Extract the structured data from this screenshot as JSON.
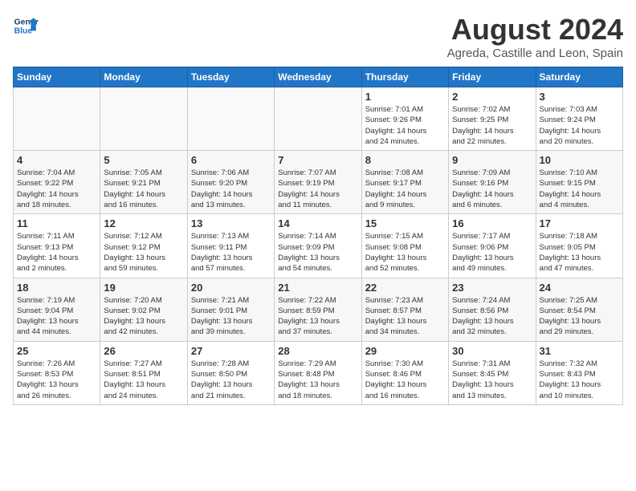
{
  "header": {
    "logo_line1": "General",
    "logo_line2": "Blue",
    "title": "August 2024",
    "subtitle": "Agreda, Castille and Leon, Spain"
  },
  "days_of_week": [
    "Sunday",
    "Monday",
    "Tuesday",
    "Wednesday",
    "Thursday",
    "Friday",
    "Saturday"
  ],
  "weeks": [
    [
      {
        "day": "",
        "content": ""
      },
      {
        "day": "",
        "content": ""
      },
      {
        "day": "",
        "content": ""
      },
      {
        "day": "",
        "content": ""
      },
      {
        "day": "1",
        "content": "Sunrise: 7:01 AM\nSunset: 9:26 PM\nDaylight: 14 hours\nand 24 minutes."
      },
      {
        "day": "2",
        "content": "Sunrise: 7:02 AM\nSunset: 9:25 PM\nDaylight: 14 hours\nand 22 minutes."
      },
      {
        "day": "3",
        "content": "Sunrise: 7:03 AM\nSunset: 9:24 PM\nDaylight: 14 hours\nand 20 minutes."
      }
    ],
    [
      {
        "day": "4",
        "content": "Sunrise: 7:04 AM\nSunset: 9:22 PM\nDaylight: 14 hours\nand 18 minutes."
      },
      {
        "day": "5",
        "content": "Sunrise: 7:05 AM\nSunset: 9:21 PM\nDaylight: 14 hours\nand 16 minutes."
      },
      {
        "day": "6",
        "content": "Sunrise: 7:06 AM\nSunset: 9:20 PM\nDaylight: 14 hours\nand 13 minutes."
      },
      {
        "day": "7",
        "content": "Sunrise: 7:07 AM\nSunset: 9:19 PM\nDaylight: 14 hours\nand 11 minutes."
      },
      {
        "day": "8",
        "content": "Sunrise: 7:08 AM\nSunset: 9:17 PM\nDaylight: 14 hours\nand 9 minutes."
      },
      {
        "day": "9",
        "content": "Sunrise: 7:09 AM\nSunset: 9:16 PM\nDaylight: 14 hours\nand 6 minutes."
      },
      {
        "day": "10",
        "content": "Sunrise: 7:10 AM\nSunset: 9:15 PM\nDaylight: 14 hours\nand 4 minutes."
      }
    ],
    [
      {
        "day": "11",
        "content": "Sunrise: 7:11 AM\nSunset: 9:13 PM\nDaylight: 14 hours\nand 2 minutes."
      },
      {
        "day": "12",
        "content": "Sunrise: 7:12 AM\nSunset: 9:12 PM\nDaylight: 13 hours\nand 59 minutes."
      },
      {
        "day": "13",
        "content": "Sunrise: 7:13 AM\nSunset: 9:11 PM\nDaylight: 13 hours\nand 57 minutes."
      },
      {
        "day": "14",
        "content": "Sunrise: 7:14 AM\nSunset: 9:09 PM\nDaylight: 13 hours\nand 54 minutes."
      },
      {
        "day": "15",
        "content": "Sunrise: 7:15 AM\nSunset: 9:08 PM\nDaylight: 13 hours\nand 52 minutes."
      },
      {
        "day": "16",
        "content": "Sunrise: 7:17 AM\nSunset: 9:06 PM\nDaylight: 13 hours\nand 49 minutes."
      },
      {
        "day": "17",
        "content": "Sunrise: 7:18 AM\nSunset: 9:05 PM\nDaylight: 13 hours\nand 47 minutes."
      }
    ],
    [
      {
        "day": "18",
        "content": "Sunrise: 7:19 AM\nSunset: 9:04 PM\nDaylight: 13 hours\nand 44 minutes."
      },
      {
        "day": "19",
        "content": "Sunrise: 7:20 AM\nSunset: 9:02 PM\nDaylight: 13 hours\nand 42 minutes."
      },
      {
        "day": "20",
        "content": "Sunrise: 7:21 AM\nSunset: 9:01 PM\nDaylight: 13 hours\nand 39 minutes."
      },
      {
        "day": "21",
        "content": "Sunrise: 7:22 AM\nSunset: 8:59 PM\nDaylight: 13 hours\nand 37 minutes."
      },
      {
        "day": "22",
        "content": "Sunrise: 7:23 AM\nSunset: 8:57 PM\nDaylight: 13 hours\nand 34 minutes."
      },
      {
        "day": "23",
        "content": "Sunrise: 7:24 AM\nSunset: 8:56 PM\nDaylight: 13 hours\nand 32 minutes."
      },
      {
        "day": "24",
        "content": "Sunrise: 7:25 AM\nSunset: 8:54 PM\nDaylight: 13 hours\nand 29 minutes."
      }
    ],
    [
      {
        "day": "25",
        "content": "Sunrise: 7:26 AM\nSunset: 8:53 PM\nDaylight: 13 hours\nand 26 minutes."
      },
      {
        "day": "26",
        "content": "Sunrise: 7:27 AM\nSunset: 8:51 PM\nDaylight: 13 hours\nand 24 minutes."
      },
      {
        "day": "27",
        "content": "Sunrise: 7:28 AM\nSunset: 8:50 PM\nDaylight: 13 hours\nand 21 minutes."
      },
      {
        "day": "28",
        "content": "Sunrise: 7:29 AM\nSunset: 8:48 PM\nDaylight: 13 hours\nand 18 minutes."
      },
      {
        "day": "29",
        "content": "Sunrise: 7:30 AM\nSunset: 8:46 PM\nDaylight: 13 hours\nand 16 minutes."
      },
      {
        "day": "30",
        "content": "Sunrise: 7:31 AM\nSunset: 8:45 PM\nDaylight: 13 hours\nand 13 minutes."
      },
      {
        "day": "31",
        "content": "Sunrise: 7:32 AM\nSunset: 8:43 PM\nDaylight: 13 hours\nand 10 minutes."
      }
    ]
  ]
}
